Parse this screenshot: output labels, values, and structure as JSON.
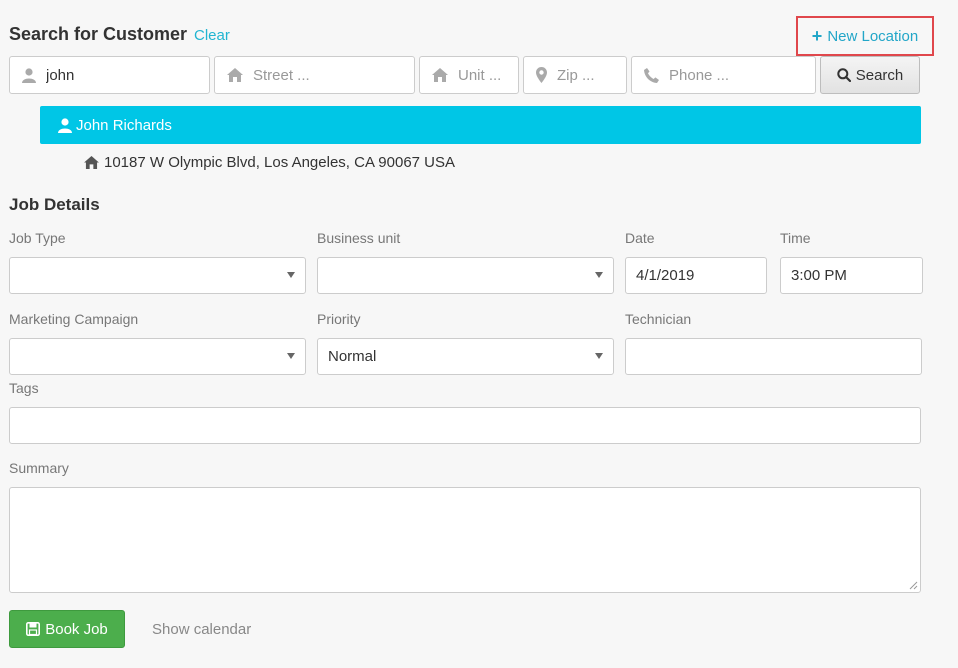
{
  "search": {
    "title": "Search for Customer",
    "clear_label": "Clear",
    "new_location_label": "New Location",
    "name_value": "john",
    "street_placeholder": "Street ...",
    "unit_placeholder": "Unit ...",
    "zip_placeholder": "Zip ...",
    "phone_placeholder": "Phone ...",
    "search_button_label": "Search"
  },
  "result": {
    "customer_name": "John Richards",
    "address": "10187 W Olympic Blvd, Los Angeles, CA 90067 USA"
  },
  "job": {
    "section_title": "Job Details",
    "job_type_label": "Job Type",
    "job_type_value": "",
    "business_unit_label": "Business unit",
    "business_unit_value": "",
    "date_label": "Date",
    "date_value": "4/1/2019",
    "time_label": "Time",
    "time_value": "3:00 PM",
    "marketing_label": "Marketing Campaign",
    "marketing_value": "",
    "priority_label": "Priority",
    "priority_value": "Normal",
    "technician_label": "Technician",
    "technician_value": "",
    "tags_label": "Tags",
    "tags_value": "",
    "summary_label": "Summary",
    "summary_value": ""
  },
  "actions": {
    "book_label": "Book Job",
    "show_calendar_label": "Show calendar"
  },
  "colors": {
    "accent": "#22b5d1",
    "customer_bar": "#00c6e6",
    "book_button": "#4cae4c",
    "highlight_border": "#e0474c"
  },
  "icons": [
    "user-icon",
    "home-icon",
    "map-marker-icon",
    "phone-icon",
    "search-icon",
    "plus-icon",
    "save-icon",
    "caret-down-icon"
  ]
}
